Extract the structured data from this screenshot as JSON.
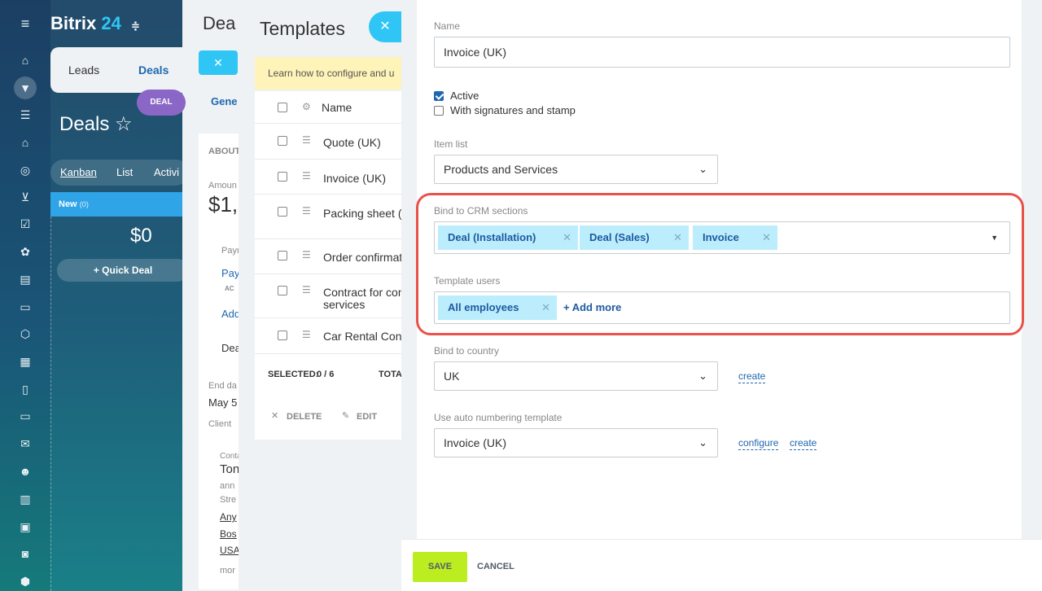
{
  "app": {
    "logo_text": "Bitrix",
    "logo_num": "24",
    "logo_switch": "≑"
  },
  "crm": {
    "tab_leads": "Leads",
    "tab_deals": "Deals",
    "deal_pill": "DEAL",
    "page_title": "Deals ☆",
    "views": {
      "kanban": "Kanban",
      "list": "List",
      "activities": "Activi"
    },
    "stage_name": "New",
    "stage_count": "(0)",
    "stage_sum": "$0",
    "quick_deal": "+ Quick Deal"
  },
  "deal": {
    "title": "Dea",
    "tab": "Gene",
    "about": "ABOUT",
    "amount_label": "Amoun",
    "amount_value": "$1,",
    "pay_label": "Paym",
    "pay_link": "Paym",
    "pay_badge": "AC",
    "add_link": "Add",
    "deal_text": "Dea",
    "end_label": "End da",
    "end_value": "May 5",
    "client_label": "Client",
    "contact_label": "Conta",
    "contact_name": "Ton",
    "contact_email": "ann",
    "contact_street": "Stre",
    "contact_city": "Any",
    "contact_city2": "Bos",
    "contact_country": "USA",
    "contact_more": "mor"
  },
  "templates": {
    "title": "Templates",
    "note": "Learn how to configure and u",
    "header_name": "Name",
    "rows": [
      {
        "name": "Quote (UK)"
      },
      {
        "name": "Invoice (UK)"
      },
      {
        "name": "Packing sheet (U"
      },
      {
        "name": "Order confirmat"
      },
      {
        "name": "Contract for con",
        "name2": "services"
      },
      {
        "name": "Car Rental Contr"
      }
    ],
    "selected_label": "SELECTED:",
    "selected_value": "0 / 6",
    "total_label": "TOTA",
    "delete_label": "DELETE",
    "edit_label": "EDIT"
  },
  "form": {
    "name_label": "Name",
    "name_value": "Invoice (UK)",
    "active_label": "Active",
    "signatures_label": "With signatures and stamp",
    "item_list_label": "Item list",
    "item_list_value": "Products and Services",
    "bind_crm_label": "Bind to CRM sections",
    "crm_tags": [
      {
        "label": "Deal (Installation)"
      },
      {
        "label": "Deal (Sales)"
      },
      {
        "label": "Invoice"
      }
    ],
    "template_users_label": "Template users",
    "user_tags": [
      {
        "label": "All employees"
      }
    ],
    "add_more": "+ Add more",
    "country_label": "Bind to country",
    "country_value": "UK",
    "country_create": "create",
    "numbering_label": "Use auto numbering template",
    "numbering_value": "Invoice (UK)",
    "numbering_configure": "configure",
    "numbering_create": "create"
  },
  "footer": {
    "save": "SAVE",
    "cancel": "CANCEL"
  },
  "colors": {
    "accent": "#2fc6f6",
    "save_button": "#bbed21",
    "tag_bg": "#bcedfc",
    "highlight": "#e9524b"
  }
}
